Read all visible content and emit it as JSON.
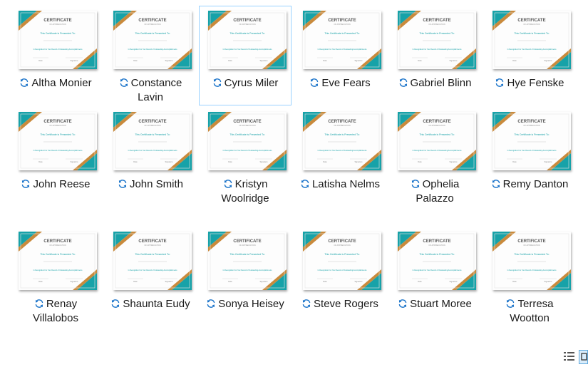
{
  "files": [
    {
      "name": "Altha Monier",
      "selected": false
    },
    {
      "name": "Constance Lavin",
      "selected": false
    },
    {
      "name": "Cyrus Miler",
      "selected": true
    },
    {
      "name": "Eve Fears",
      "selected": false
    },
    {
      "name": "Gabriel Blinn",
      "selected": false
    },
    {
      "name": "Hye Fenske",
      "selected": false
    },
    {
      "name": "John Reese",
      "selected": false
    },
    {
      "name": "John Smith",
      "selected": false
    },
    {
      "name": "Kristyn Woolridge",
      "selected": false
    },
    {
      "name": "Latisha Nelms",
      "selected": false
    },
    {
      "name": "Ophelia Palazzo",
      "selected": false
    },
    {
      "name": "Remy Danton",
      "selected": false
    },
    {
      "name": "Renay Villalobos",
      "selected": false
    },
    {
      "name": "Shaunta Eudy",
      "selected": false
    },
    {
      "name": "Sonya Heisey",
      "selected": false
    },
    {
      "name": "Steve Rogers",
      "selected": false
    },
    {
      "name": "Stuart Moree",
      "selected": false
    },
    {
      "name": "Terresa Wootton",
      "selected": false
    }
  ],
  "thumbnail": {
    "title": "CERTIFICATE",
    "subtitle": "OF APPRECIATION",
    "presented": "This Certificate is Presented To:",
    "recognition": "In Recognition For Your Record of Outstanding Accomplishments",
    "date_label": "Date",
    "signature_label": "Signature"
  },
  "icons": {
    "sync": "sync-pending-icon",
    "details_view": "details-view-icon",
    "large_icons_view": "large-icons-view-icon"
  },
  "colors": {
    "teal": "#17a2a8",
    "orange": "#c98a3c",
    "selected_border": "#99d1ff",
    "sync_blue": "#1a73c9"
  }
}
